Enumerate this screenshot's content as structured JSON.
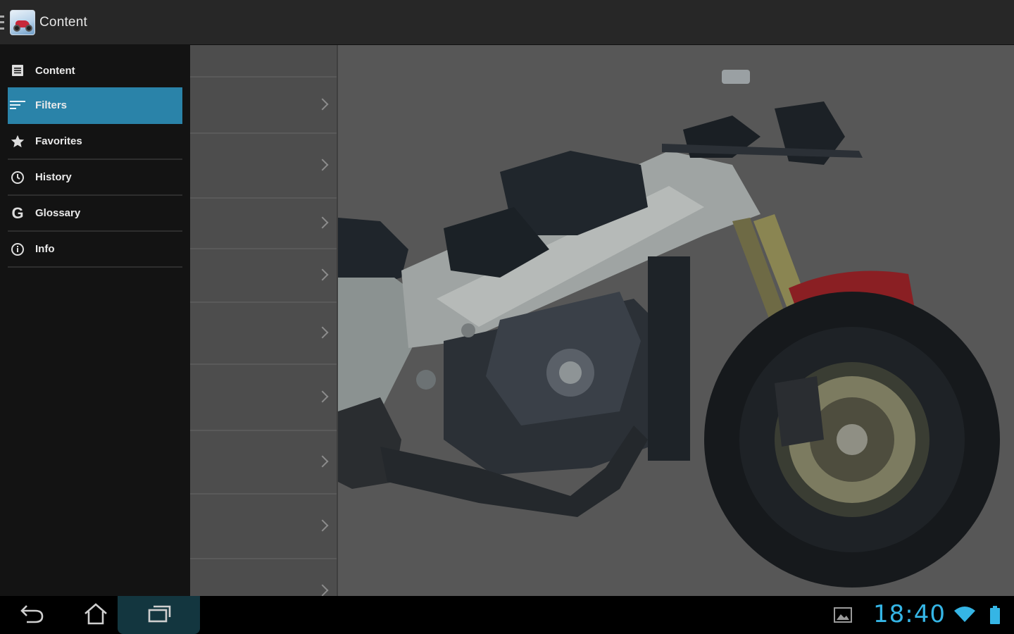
{
  "actionbar": {
    "title": "Content",
    "app_icon": "motorcycle-app-icon"
  },
  "sidebar": {
    "items": [
      {
        "label": "Content",
        "icon": "list-icon",
        "active": false
      },
      {
        "label": "Filters",
        "icon": "filter-icon",
        "active": true
      },
      {
        "label": "Favorites",
        "icon": "star-icon",
        "active": false
      },
      {
        "label": "History",
        "icon": "clock-icon",
        "active": false
      },
      {
        "label": "Glossary",
        "icon": "glossary-g-icon",
        "active": false
      },
      {
        "label": "Info",
        "icon": "info-icon",
        "active": false
      }
    ],
    "accent_color": "#2a83a9"
  },
  "list": {
    "row_count": 9,
    "row_icon": "chevron-right-icon"
  },
  "image": {
    "subject": "stripped-motorcycle-photo"
  },
  "systembar": {
    "clock": "18:40",
    "clock_color": "#35b5e5",
    "buttons": [
      "back-icon",
      "home-icon",
      "recent-apps-icon"
    ],
    "status_icons": [
      "gallery-notification-icon",
      "wifi-icon",
      "battery-icon"
    ]
  }
}
